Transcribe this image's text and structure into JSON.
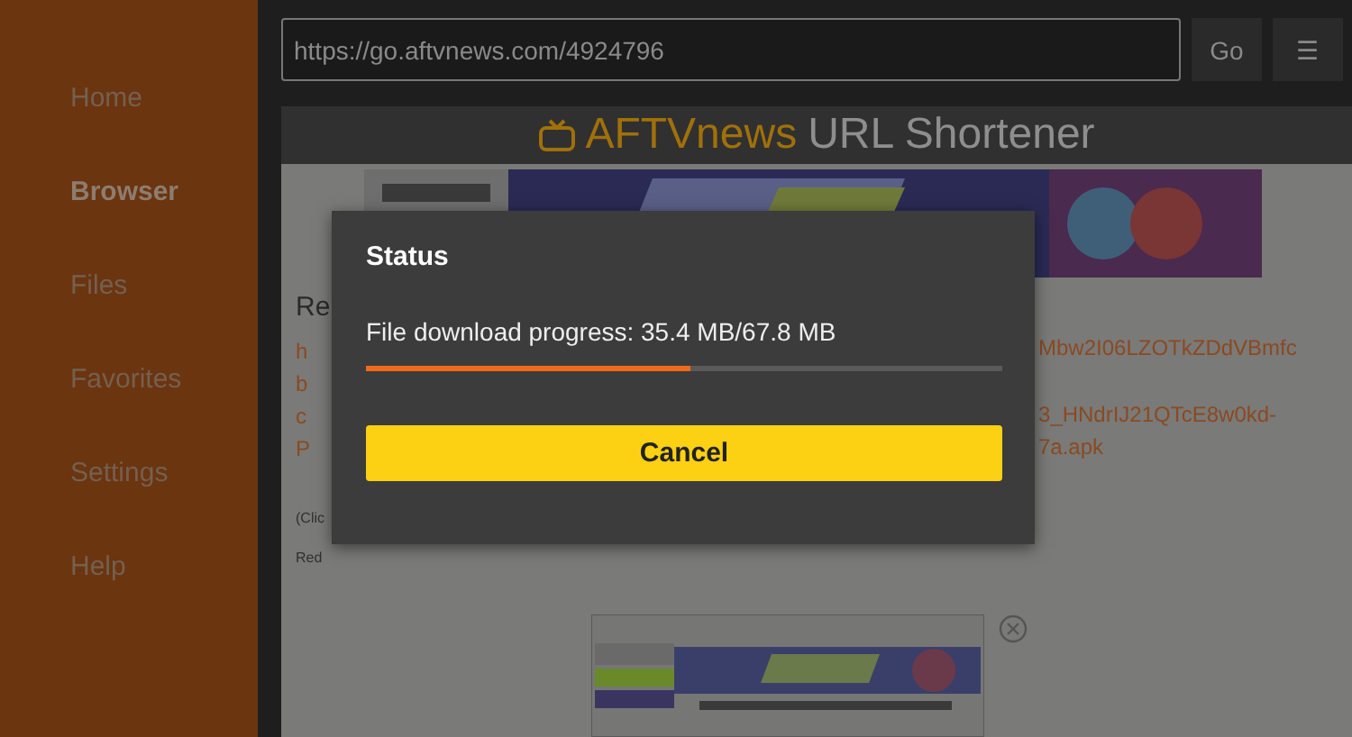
{
  "sidebar": {
    "items": [
      {
        "label": "Home",
        "selected": false
      },
      {
        "label": "Browser",
        "selected": true
      },
      {
        "label": "Files",
        "selected": false
      },
      {
        "label": "Favorites",
        "selected": false
      },
      {
        "label": "Settings",
        "selected": false
      },
      {
        "label": "Help",
        "selected": false
      }
    ]
  },
  "address_bar": {
    "value": "https://go.aftvnews.com/4924796",
    "go_button": "Go",
    "menu_button": "☰"
  },
  "page": {
    "header": {
      "brand": "AFTVnews",
      "title": "URL Shortener"
    },
    "left_fragments": [
      {
        "text": "Re",
        "kind": "heading"
      },
      {
        "text": "h",
        "kind": "link"
      },
      {
        "text": "b",
        "kind": "link"
      },
      {
        "text": "c",
        "kind": "link"
      },
      {
        "text": "P",
        "kind": "link"
      },
      {
        "text": "(Clic",
        "kind": "note"
      },
      {
        "text": "Red",
        "kind": "note"
      }
    ],
    "right_fragments": [
      {
        "text": "Mbw2I06LZOTkZDdVBmfc",
        "kind": "link"
      },
      {
        "text": "3_HNdrIJ21QTcE8w0kd-",
        "kind": "link"
      },
      {
        "text": "7a.apk",
        "kind": "link"
      }
    ]
  },
  "dialog": {
    "title": "Status",
    "message": "File download progress: 35.4 MB/67.8 MB",
    "level": 0.51,
    "button": "Cancel"
  }
}
